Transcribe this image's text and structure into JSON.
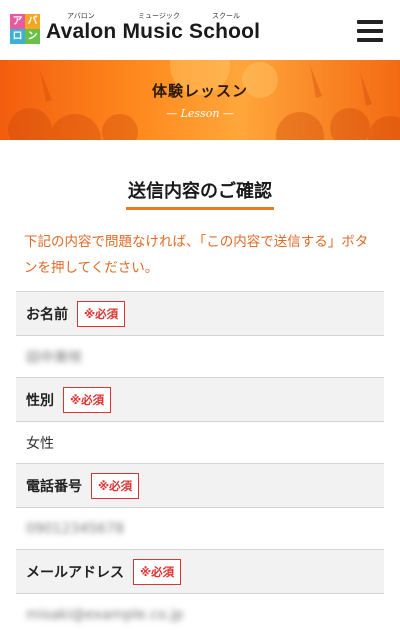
{
  "header": {
    "logo_mark": [
      "ア",
      "バ",
      "ロ",
      "ン"
    ],
    "brand_name": "Avalon Music School",
    "ruby": [
      "アバロン",
      "ミュージック",
      "スクール"
    ]
  },
  "banner": {
    "title": "体験レッスン",
    "subtitle": "— Lesson —"
  },
  "confirm": {
    "title": "送信内容のご確認",
    "notice": "下記の内容で問題なければ、「この内容で送信する」ボタンを押してください。"
  },
  "form": {
    "required_label": "※必須",
    "fields": [
      {
        "label": "お名前",
        "value": "田中美咲"
      },
      {
        "label": "性別",
        "value": "女性"
      },
      {
        "label": "電話番号",
        "value": "09012345678"
      },
      {
        "label": "メールアドレス",
        "value": "misaki@example.co.jp"
      }
    ]
  }
}
